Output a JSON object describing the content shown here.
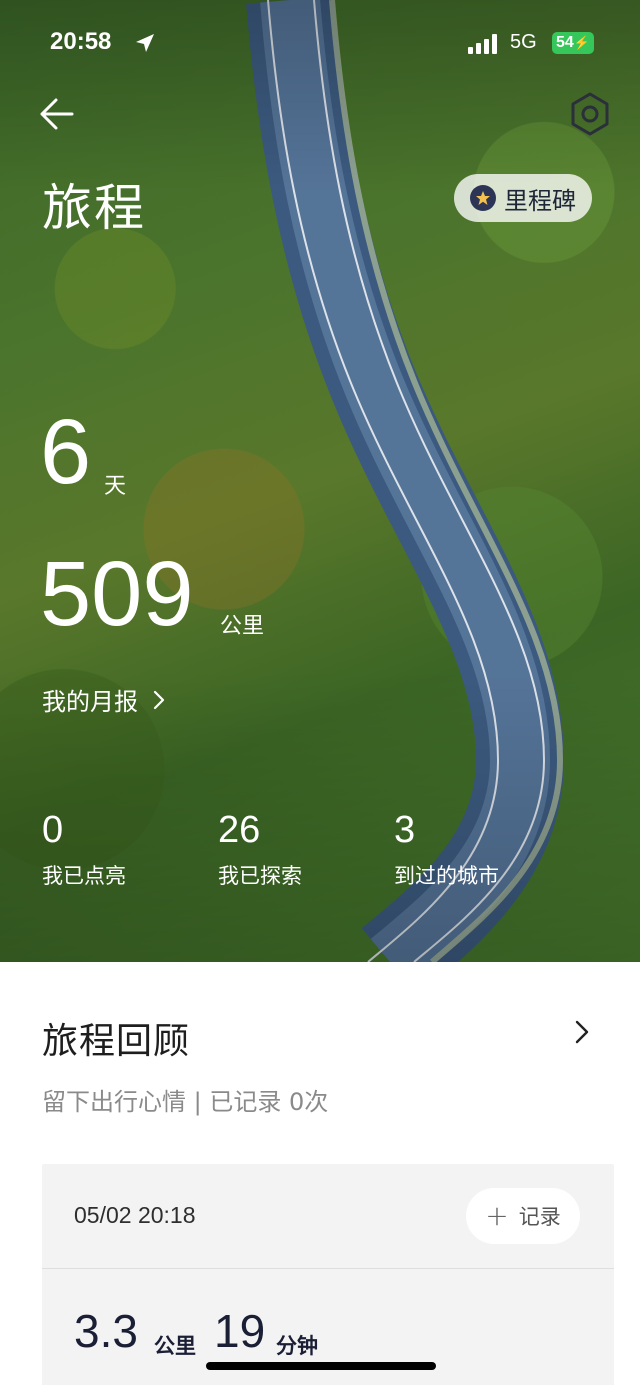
{
  "status_bar": {
    "time": "20:58",
    "network": "5G",
    "battery": "54",
    "battery_color": "#35c759"
  },
  "header": {
    "title": "旅程",
    "back_icon": "arrow-left-icon",
    "settings_icon": "hexagon-gear-icon",
    "milestone_label": "里程碑",
    "milestone_icon": "star-badge-icon"
  },
  "stats": {
    "days_value": "6",
    "days_unit": "天",
    "km_value": "509",
    "km_unit": "公里",
    "monthly_report_label": "我的月报",
    "items": [
      {
        "value": "0",
        "label": "我已点亮"
      },
      {
        "value": "26",
        "label": "我已探索"
      },
      {
        "value": "3",
        "label": "到过的城市"
      }
    ]
  },
  "review": {
    "title": "旅程回顾",
    "subtitle": "留下出行心情 | 已记录 0次",
    "card": {
      "datetime": "05/02 20:18",
      "record_label": "记录",
      "distance_value": "3.3",
      "distance_unit": "公里",
      "duration_value": "19",
      "duration_unit": "分钟"
    }
  },
  "colors": {
    "accent_dark": "#1b1f36",
    "road": "#4d6f98"
  }
}
